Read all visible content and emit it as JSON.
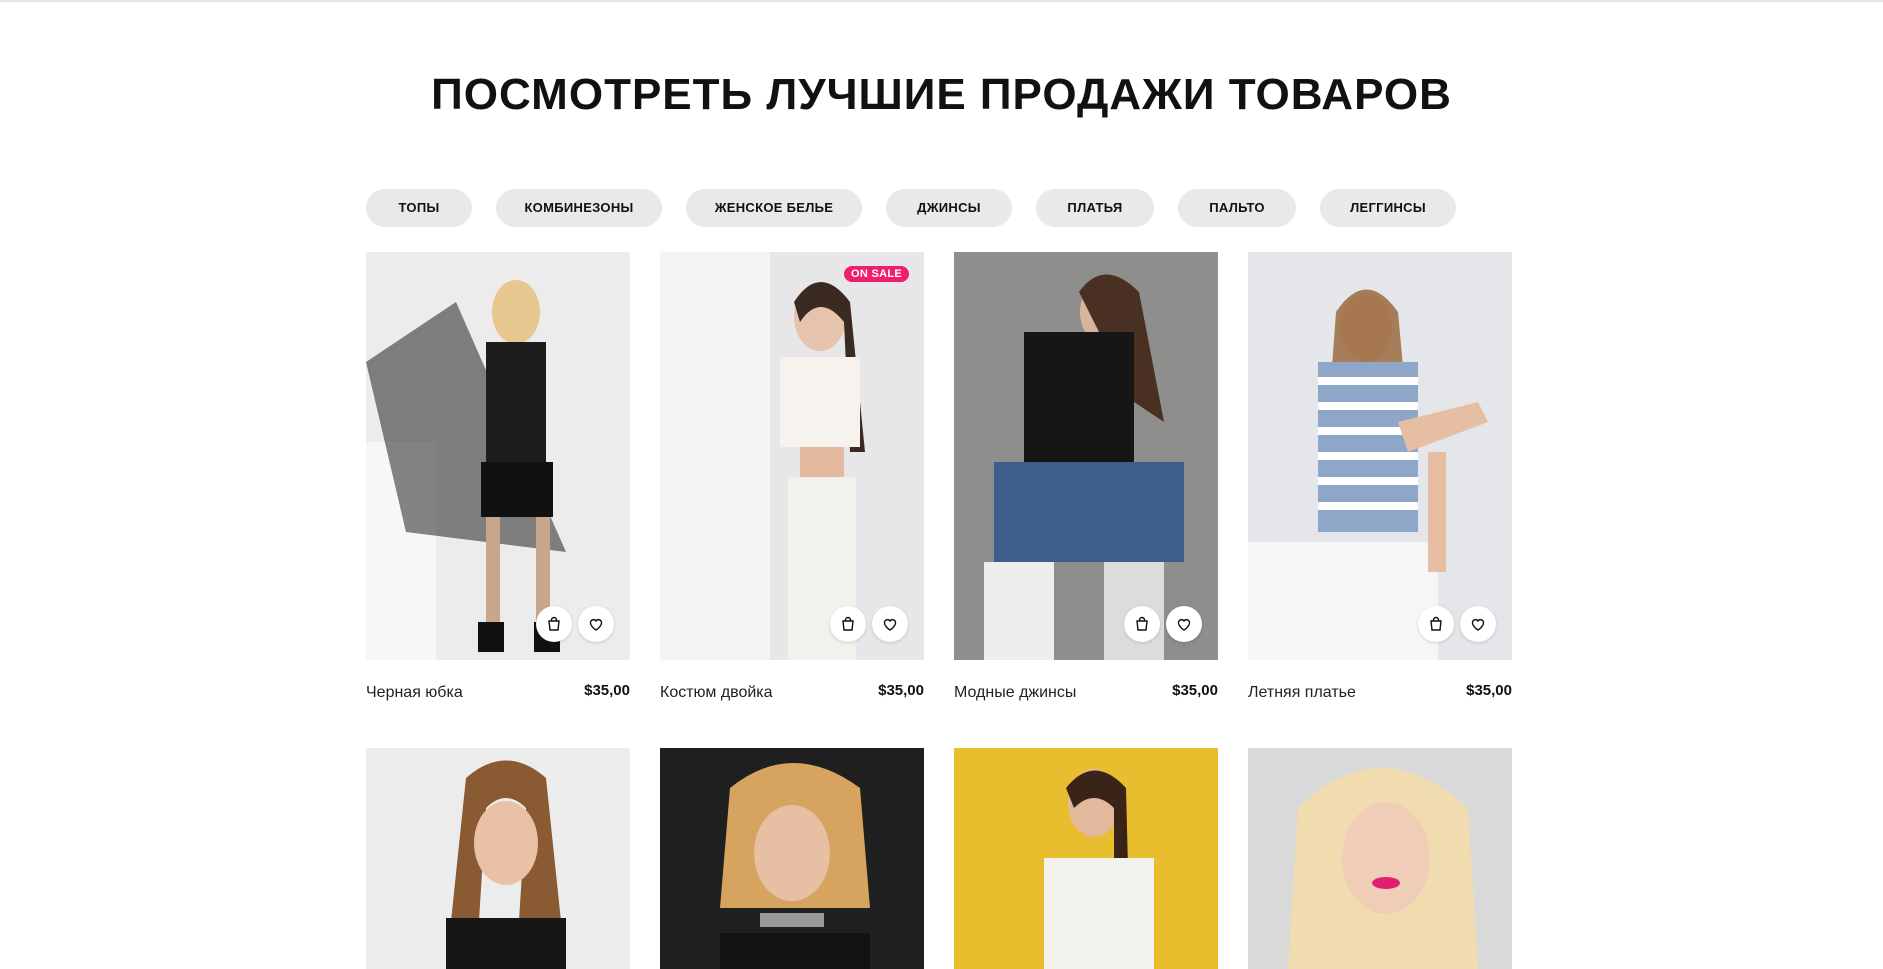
{
  "section": {
    "title": "ПОСМОТРЕТЬ ЛУЧШИЕ ПРОДАЖИ ТОВАРОВ"
  },
  "tabs": [
    "ТОПЫ",
    "КОМБИНЕЗОНЫ",
    "ЖЕНСКОЕ БЕЛЬЕ",
    "ДЖИНСЫ",
    "ПЛАТЬЯ",
    "ПАЛЬТО",
    "ЛЕГГИНСЫ"
  ],
  "products": [
    {
      "name": "Черная юбка",
      "price": "$35,00",
      "badge": ""
    },
    {
      "name": "Костюм двойка",
      "price": "$35,00",
      "badge": "ON SALE"
    },
    {
      "name": "Модные джинсы",
      "price": "$35,00",
      "badge": ""
    },
    {
      "name": "Летняя платье",
      "price": "$35,00",
      "badge": ""
    }
  ],
  "colors": {
    "accent": "#ef1f6b",
    "tab_bg": "#e9e9e9"
  },
  "icons": {
    "cart": "shopping-bag-icon",
    "wishlist": "heart-icon"
  }
}
